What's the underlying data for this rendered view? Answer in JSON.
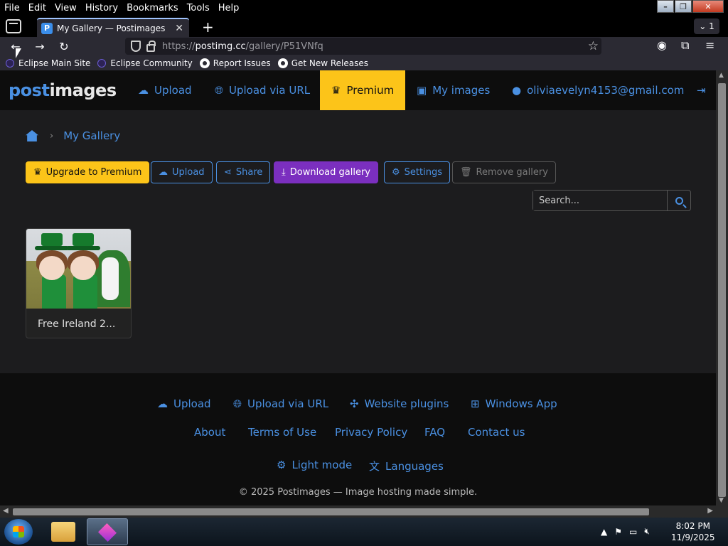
{
  "menu": [
    "File",
    "Edit",
    "View",
    "History",
    "Bookmarks",
    "Tools",
    "Help"
  ],
  "tab": {
    "title": "My Gallery — Postimages",
    "favicon": "P",
    "close": "✕"
  },
  "tab_count": "1",
  "url": {
    "prefix": "https://",
    "host": "postimg.cc",
    "path": "/gallery/P51VNfq"
  },
  "bookmarks": [
    "Eclipse Main Site",
    "Eclipse Community",
    "Report Issues",
    "Get New Releases"
  ],
  "site": {
    "logo_a": "post",
    "logo_b": "images",
    "nav": {
      "upload": "Upload",
      "upload_url": "Upload via URL",
      "premium": "Premium",
      "my_images": "My images",
      "account": "oliviaevelyn4153@gmail.com"
    }
  },
  "breadcrumb": {
    "current": "My Gallery"
  },
  "actions": {
    "upgrade": "Upgrade to Premium",
    "upload": "Upload",
    "share": "Share",
    "download": "Download gallery",
    "settings": "Settings",
    "remove": "Remove gallery"
  },
  "search": {
    "placeholder": "Search..."
  },
  "gallery": [
    {
      "caption": "Free Ireland 2..."
    }
  ],
  "footer": {
    "row1": [
      "Upload",
      "Upload via URL",
      "Website plugins",
      "Windows App"
    ],
    "row2": [
      "About",
      "Terms of Use",
      "Privacy Policy",
      "FAQ",
      "Contact us"
    ],
    "row3": [
      "Light mode",
      "Languages"
    ],
    "copyright": "© 2025 Postimages — Image hosting made simple."
  },
  "clock": {
    "time": "8:02 PM",
    "date": "11/9/2025"
  },
  "colors": {
    "accent": "#4a90e2",
    "premium": "#fcc419",
    "download": "#7b2fbf"
  }
}
